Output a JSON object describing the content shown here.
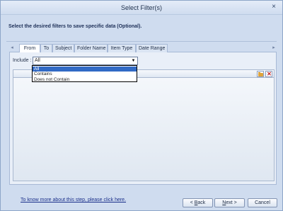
{
  "window": {
    "title": "Select Filter(s)",
    "close_glyph": "×"
  },
  "instructions": "Select the desired filters to save specific data (Optional).",
  "tabs": [
    {
      "label": "From",
      "active": true
    },
    {
      "label": "To",
      "active": false
    },
    {
      "label": "Subject",
      "active": false
    },
    {
      "label": "Folder Name",
      "active": false
    },
    {
      "label": "Item Type",
      "active": false
    },
    {
      "label": "Date Range",
      "active": false
    }
  ],
  "tab_scroll": {
    "left": "◂",
    "right": "▸"
  },
  "include": {
    "label": "Include :",
    "selected": "All",
    "arrow_glyph": "▼",
    "options": [
      "All",
      "Contains",
      "Does not Contain"
    ]
  },
  "grid_tools": {
    "open_icon": "folder-open-icon",
    "delete_icon": "delete-icon",
    "delete_glyph": "✕"
  },
  "footer": {
    "help_link": "To know more about this step, please click here.",
    "back_prefix": "< ",
    "back_key": "B",
    "back_rest": "ack",
    "next_key": "N",
    "next_rest": "ext >",
    "cancel": "Cancel"
  },
  "colors": {
    "window_bg": "#cfdcef",
    "selected_option": "#316ac5",
    "link": "#1a2f8a",
    "delete_red": "#c42020",
    "folder_yellow": "#e0a43a"
  }
}
